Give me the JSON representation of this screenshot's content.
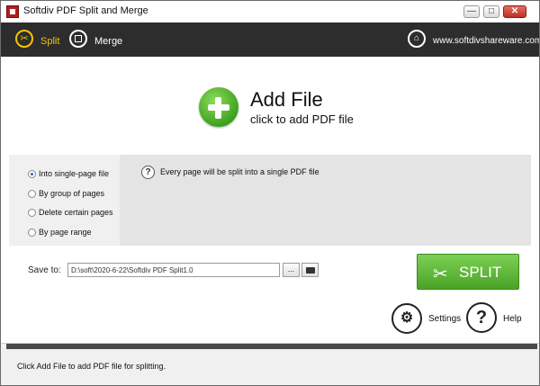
{
  "window": {
    "title": "Softdiv PDF Split and Merge"
  },
  "toolbar": {
    "split_label": "Split",
    "merge_label": "Merge",
    "website": "www.softdivshareware.com"
  },
  "main": {
    "add_file_title": "Add File",
    "add_file_subtitle": "click to add PDF file",
    "options": [
      {
        "label": "Into single-page file",
        "selected": true
      },
      {
        "label": "By group of pages",
        "selected": false
      },
      {
        "label": "Delete certain pages",
        "selected": false
      },
      {
        "label": "By page range",
        "selected": false
      }
    ],
    "description": "Every page will be split into a single PDF file",
    "save_to_label": "Save to:",
    "save_path": "D:\\soft\\2020-6-22\\Softdiv PDF Split1.0",
    "browse_label": "...",
    "split_button": "SPLIT",
    "settings_label": "Settings",
    "help_label": "Help"
  },
  "status": {
    "text": "Click Add File to add PDF file for splitting."
  },
  "colors": {
    "split_accent": "#f5c400",
    "split_button": "#5cb531",
    "toolbar_bg": "#2d2d2d"
  }
}
